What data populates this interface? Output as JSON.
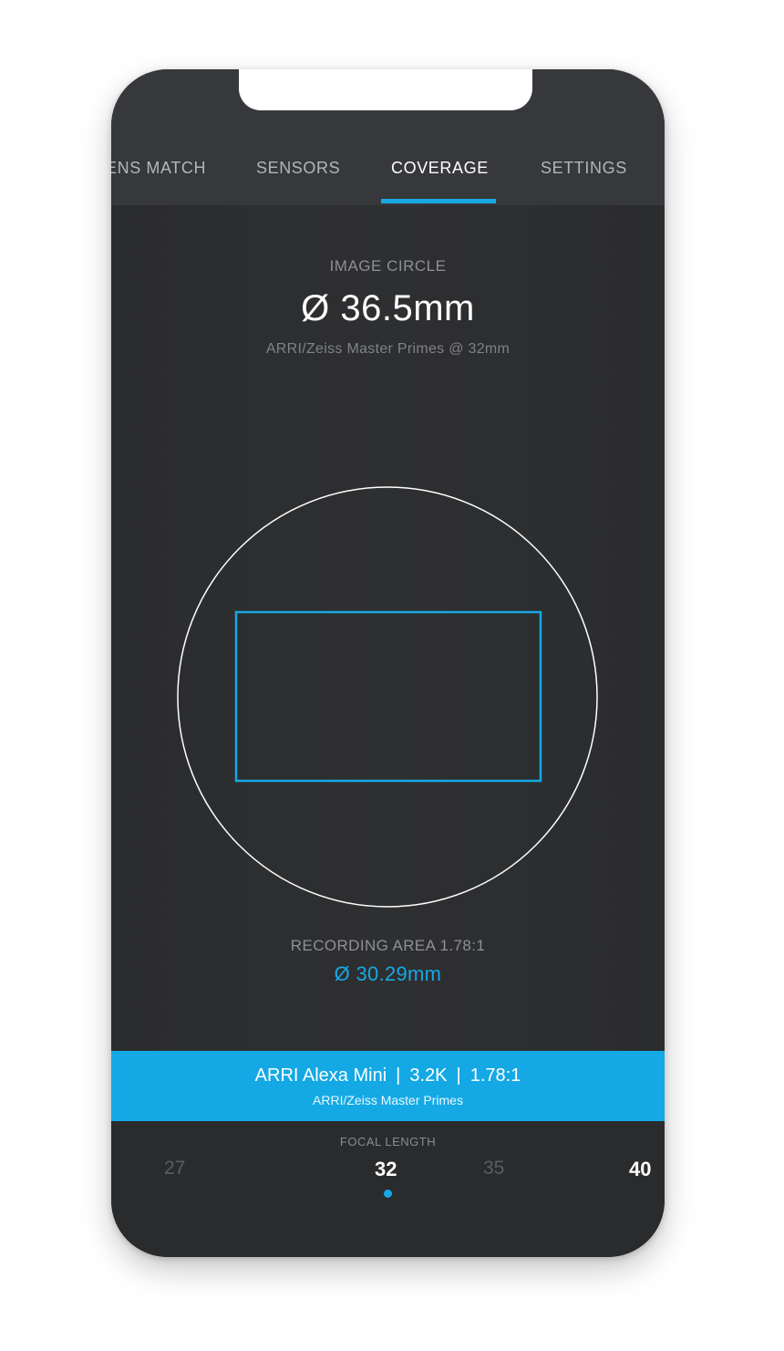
{
  "tabs": {
    "items": [
      {
        "label": "LENS MATCH",
        "visible_label": "ENS MATCH"
      },
      {
        "label": "SENSORS"
      },
      {
        "label": "COVERAGE"
      },
      {
        "label": "SETTINGS"
      }
    ],
    "active": "COVERAGE"
  },
  "image_circle": {
    "label": "IMAGE CIRCLE",
    "value": "Ø 36.5mm",
    "lens": "ARRI/Zeiss Master Primes @ 32mm"
  },
  "recording_area": {
    "label": "RECORDING AREA 1.78:1",
    "value": "Ø 30.29mm"
  },
  "camera_bar": {
    "camera": "ARRI Alexa Mini",
    "resolution": "3.2K",
    "aspect": "1.78:1",
    "separator": "|",
    "lens_set": "ARRI/Zeiss Master Primes"
  },
  "focal_length": {
    "label": "FOCAL LENGTH",
    "values": [
      "27",
      "32",
      "35",
      "40"
    ],
    "selected": "32"
  },
  "colors": {
    "accent": "#17a8e3",
    "background": "#2b2c2e",
    "tabbar": "#37383b",
    "circle_stroke": "#ffffff",
    "sensor_stroke": "#17a8e3"
  },
  "icons": {
    "selected_indicator": "dot-icon"
  }
}
